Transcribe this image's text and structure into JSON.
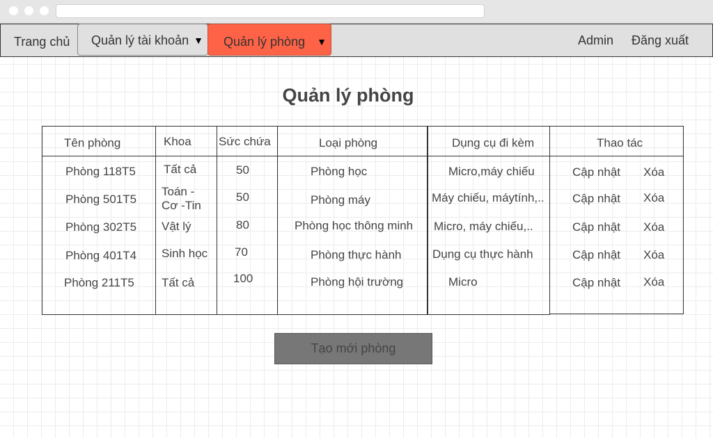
{
  "nav": {
    "home": "Trang chủ",
    "accounts": "Quản lý tài khoản",
    "rooms": "Quản lý phòng",
    "caret": "▼",
    "user": "Admin",
    "logout": "Đăng xuất"
  },
  "colors": {
    "active_tab": "#ff6347",
    "button": "#777777"
  },
  "page": {
    "title": "Quản lý phòng",
    "create_button": "Tạo mới phòng"
  },
  "table": {
    "headers": {
      "name": "Tên phòng",
      "faculty": "Khoa",
      "capacity": "Sức chứa",
      "type": "Loại phòng",
      "equipment": "Dụng cụ đi kèm",
      "actions": "Thao tác"
    },
    "rows": [
      {
        "name": "Phòng 118T5",
        "faculty": "Tất cả",
        "capacity": "50",
        "type": "Phòng học",
        "equipment": "Micro,máy chiếu",
        "update": "Cập nhật",
        "delete": "Xóa"
      },
      {
        "name": "Phòng 501T5",
        "faculty": "Toán - Cơ -Tin",
        "capacity": "50",
        "type": "Phòng máy",
        "equipment": "Máy chiếu, máytính,..",
        "update": "Cập nhật",
        "delete": "Xóa"
      },
      {
        "name": "Phòng 302T5",
        "faculty": "Vật lý",
        "capacity": "80",
        "type": "Phòng học thông minh",
        "equipment": "Micro, máy chiếu,..",
        "update": "Cập nhật",
        "delete": "Xóa"
      },
      {
        "name": "Phòng 401T4",
        "faculty": "Sinh học",
        "capacity": "70",
        "type": "Phòng thực hành",
        "equipment": "Dụng cụ thực hành",
        "update": "Cập nhật",
        "delete": "Xóa"
      },
      {
        "name": "Phòng 211T5",
        "faculty": "Tất cả",
        "capacity": "100",
        "type": "Phòng hội trường",
        "equipment": "Micro",
        "update": "Cập nhật",
        "delete": "Xóa"
      }
    ]
  }
}
